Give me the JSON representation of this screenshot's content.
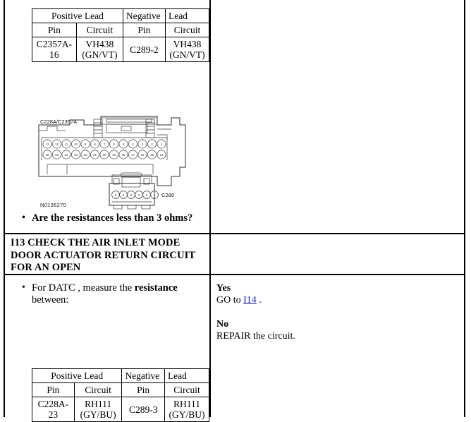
{
  "document": {
    "type": "diagnostic-procedure-page"
  },
  "step_continued": {
    "table": {
      "header_positive": "Positive Lead",
      "header_negative": "Negative",
      "header_negative2": "Lead",
      "subheaders": [
        "Pin",
        "Circuit",
        "Pin",
        "Circuit"
      ],
      "rows": [
        {
          "pos_pin": "C2357A-16",
          "pos_circuit": "VH438 (GN/VT)",
          "neg_pin": "C289-2",
          "neg_circuit": "VH438 (GN/VT)"
        }
      ]
    },
    "figure": {
      "connector_label": "C228A/C2357A",
      "secondary_connector_label": "C289",
      "figure_id": "N0135270",
      "top_row_pins": [
        "13",
        "12",
        "11",
        "10",
        "9",
        "8",
        "7",
        "6",
        "5",
        "4",
        "3",
        "2",
        "1"
      ],
      "bottom_row_pins": [
        "26",
        "25",
        "24",
        "23",
        "22",
        "21",
        "20",
        "19",
        "18",
        "17",
        "16",
        "15",
        "14"
      ],
      "c289_pins": [
        "6",
        "5",
        "4",
        "3",
        "2",
        "1"
      ]
    },
    "question": "Are the resistances less than 3 ohms?"
  },
  "step_i13": {
    "title": "I13 CHECK THE AIR INLET MODE DOOR ACTUATOR RETURN CIRCUIT FOR AN OPEN",
    "instruction_prefix": "For DATC , measure the ",
    "instruction_bold": "resistance",
    "instruction_suffix": " between:",
    "table": {
      "header_positive": "Positive Lead",
      "header_negative": "Negative",
      "header_negative2": "Lead",
      "subheaders": [
        "Pin",
        "Circuit",
        "Pin",
        "Circuit"
      ],
      "rows": [
        {
          "pos_pin": "C228A-23",
          "pos_circuit": "RH111 (GY/BU)",
          "neg_pin": "C289-3",
          "neg_circuit": "RH111 (GY/BU)"
        }
      ]
    },
    "answers": {
      "yes_label": "Yes",
      "yes_action_prefix": "GO to ",
      "yes_link": "I14",
      "yes_action_suffix": " .",
      "no_label": "No",
      "no_action": "REPAIR the circuit."
    }
  },
  "colors": {
    "link": "#2222cc",
    "border": "#000000",
    "text": "#000000"
  }
}
